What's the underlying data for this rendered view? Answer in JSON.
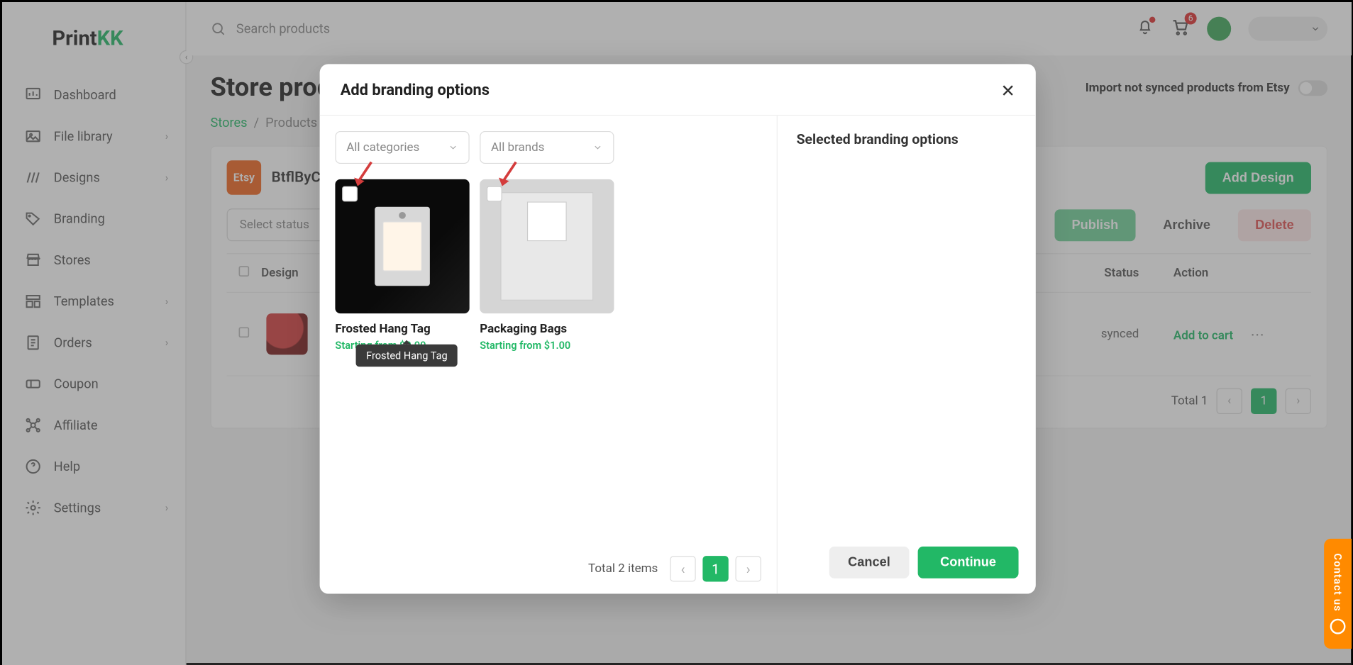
{
  "brand": {
    "part1": "Print",
    "part2": "KK"
  },
  "nav": {
    "dashboard": "Dashboard",
    "file_library": "File library",
    "designs": "Designs",
    "branding": "Branding",
    "stores": "Stores",
    "templates": "Templates",
    "orders": "Orders",
    "coupon": "Coupon",
    "affiliate": "Affiliate",
    "help": "Help",
    "settings": "Settings"
  },
  "header": {
    "search_placeholder": "Search products",
    "cart_badge": "6"
  },
  "page": {
    "title": "Store products",
    "import_label": "Import not synced products from Etsy"
  },
  "breadcrumb": {
    "stores": "Stores",
    "products": "Products"
  },
  "shop": {
    "platform": "Etsy",
    "name": "BtflByCe",
    "add_design": "Add Design",
    "select_status": "Select status",
    "publish": "Publish",
    "archive": "Archive",
    "delete": "Delete"
  },
  "table": {
    "col_design": "Design",
    "col_status": "Status",
    "col_action": "Action",
    "status_value": "synced",
    "add_to_cart": "Add to cart",
    "total_label": "Total 1",
    "page": "1"
  },
  "modal": {
    "title": "Add branding options",
    "all_categories": "All categories",
    "all_brands": "All brands",
    "selected_title": "Selected branding options",
    "total_items": "Total 2 items",
    "page": "1",
    "cancel": "Cancel",
    "continue": "Continue",
    "products": [
      {
        "name": "Frosted Hang Tag",
        "price": "Starting from $0.00"
      },
      {
        "name": "Packaging Bags",
        "price": "Starting from $1.00"
      }
    ],
    "tooltip": "Frosted Hang Tag"
  },
  "contact": "Contact us"
}
